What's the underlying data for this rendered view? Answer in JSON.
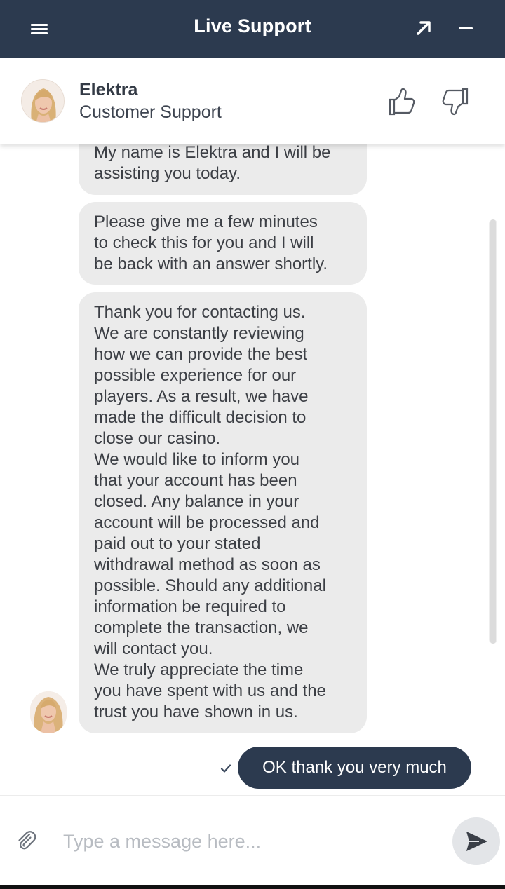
{
  "header": {
    "title": "Live Support",
    "menu_icon": "hamburger-menu-icon",
    "expand_icon": "arrow-up-right-icon",
    "minimize_icon": "minus-icon"
  },
  "agent": {
    "name": "Elektra",
    "role": "Customer Support",
    "avatar_icon": "agent-avatar",
    "rate_positive_icon": "thumbs-up-icon",
    "rate_negative_icon": "thumbs-down-icon"
  },
  "messages": [
    {
      "sender": "agent",
      "text": "My name is Elektra and I will be\nassisting you today."
    },
    {
      "sender": "agent",
      "text": "Please give me a few minutes\nto check this for you and I will\nbe back with an answer shortly."
    },
    {
      "sender": "agent",
      "text": "Thank you for contacting us.\nWe are constantly reviewing\nhow we can provide the best\npossible experience for our\nplayers. As a result, we have\nmade the difficult decision to\nclose our casino.\nWe would like to inform you\nthat your account has been\nclosed. Any balance in your\naccount will be processed and\npaid out to your stated\nwithdrawal method as soon as\npossible. Should any additional\ninformation be required to\ncomplete the transaction, we\nwill contact you.\nWe truly appreciate the time\nyou have spent with us and the\ntrust you have shown in us."
    },
    {
      "sender": "user",
      "text": "OK thank you very much",
      "status_icon": "checkmark-icon"
    }
  ],
  "composer": {
    "placeholder": "Type a message here...",
    "value": "",
    "attach_icon": "paperclip-icon",
    "send_icon": "send-icon"
  },
  "colors": {
    "header_bg": "#2c3a4f",
    "agent_bubble": "#ebebeb",
    "user_bubble": "#2c3a4f",
    "send_button_bg": "#e3e5e8",
    "placeholder": "#b8bcc2"
  }
}
